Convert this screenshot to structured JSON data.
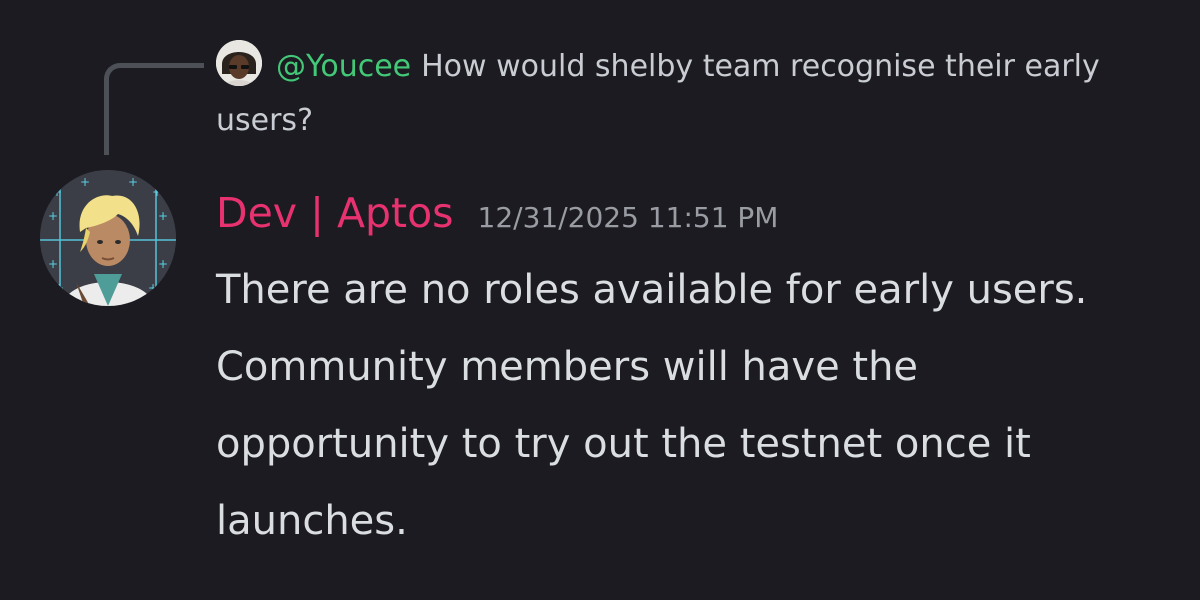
{
  "reply": {
    "author": "@Youcee",
    "text": "How would shelby team recognise their early users?"
  },
  "message": {
    "author": "Dev | Aptos",
    "timestamp": "12/31/2025 11:51 PM",
    "text": "There are no roles available for early users. Community members will have the opportunity to try out the testnet once it launches."
  },
  "colors": {
    "background": "#1b1b21",
    "reply_author": "#43c878",
    "author": "#e8326f",
    "timestamp": "#9a9ca4",
    "text": "#dbdee1"
  },
  "icons": {
    "reply_avatar": "user-avatar-illustration",
    "author_avatar": "user-avatar-illustration"
  }
}
